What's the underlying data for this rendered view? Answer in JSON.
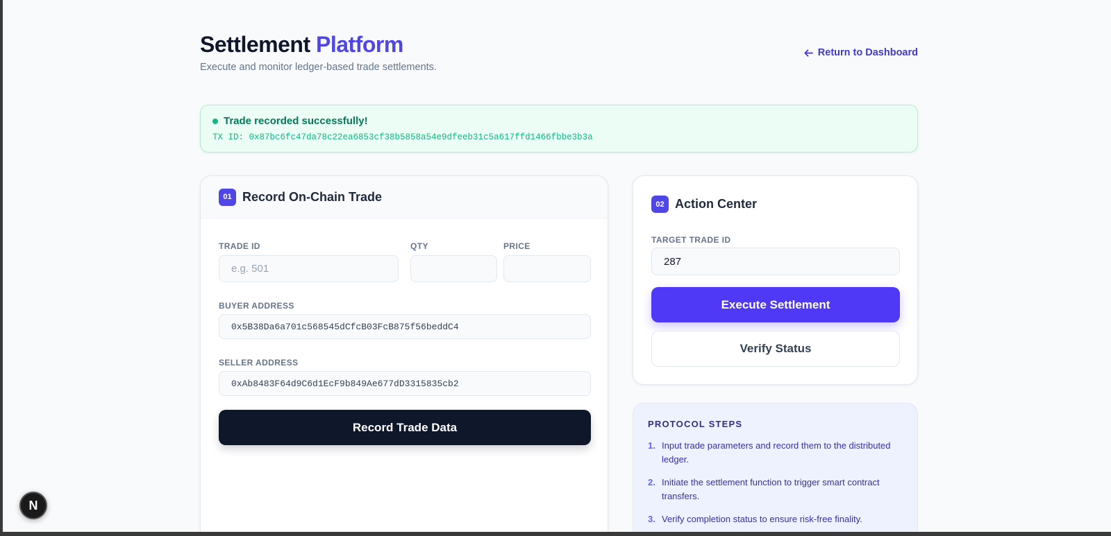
{
  "header": {
    "title_main": "Settlement",
    "title_accent": "Platform",
    "subtitle": "Execute and monitor ledger-based trade settlements.",
    "back_link": "Return to Dashboard"
  },
  "alert": {
    "title": "Trade recorded successfully!",
    "tx": "TX ID: 0x87bc6fc47da78c22ea6853cf38b5858a54e9dfeeb31c5a617ffd1466fbbe3b3a"
  },
  "record_card": {
    "badge": "01",
    "title": "Record On-Chain Trade",
    "trade_id_label": "TRADE ID",
    "trade_id_placeholder": "e.g. 501",
    "qty_label": "QTY",
    "qty_value": "",
    "price_label": "PRICE",
    "price_value": "",
    "buyer_label": "BUYER ADDRESS",
    "buyer_value": "0x5B38Da6a701c568545dCfcB03FcB875f56beddC4",
    "seller_label": "SELLER ADDRESS",
    "seller_value": "0xAb8483F64d9C6d1EcF9b849Ae677dD3315835cb2",
    "submit_label": "Record Trade Data"
  },
  "action_card": {
    "badge": "02",
    "title": "Action Center",
    "target_label": "TARGET TRADE ID",
    "target_value": "287",
    "execute_label": "Execute Settlement",
    "verify_label": "Verify Status"
  },
  "protocol": {
    "title": "PROTOCOL STEPS",
    "steps": [
      {
        "num": "1.",
        "text": "Input trade parameters and record them to the distributed ledger."
      },
      {
        "num": "2.",
        "text": "Initiate the settlement function to trigger smart contract transfers."
      },
      {
        "num": "3.",
        "text": "Verify completion status to ensure risk-free finality."
      }
    ]
  },
  "dev_badge": {
    "label": "N",
    "icon": "nextjs-icon"
  },
  "colors": {
    "accent": "#4f46e5",
    "dark": "#0f172a",
    "success": "#10b981"
  }
}
